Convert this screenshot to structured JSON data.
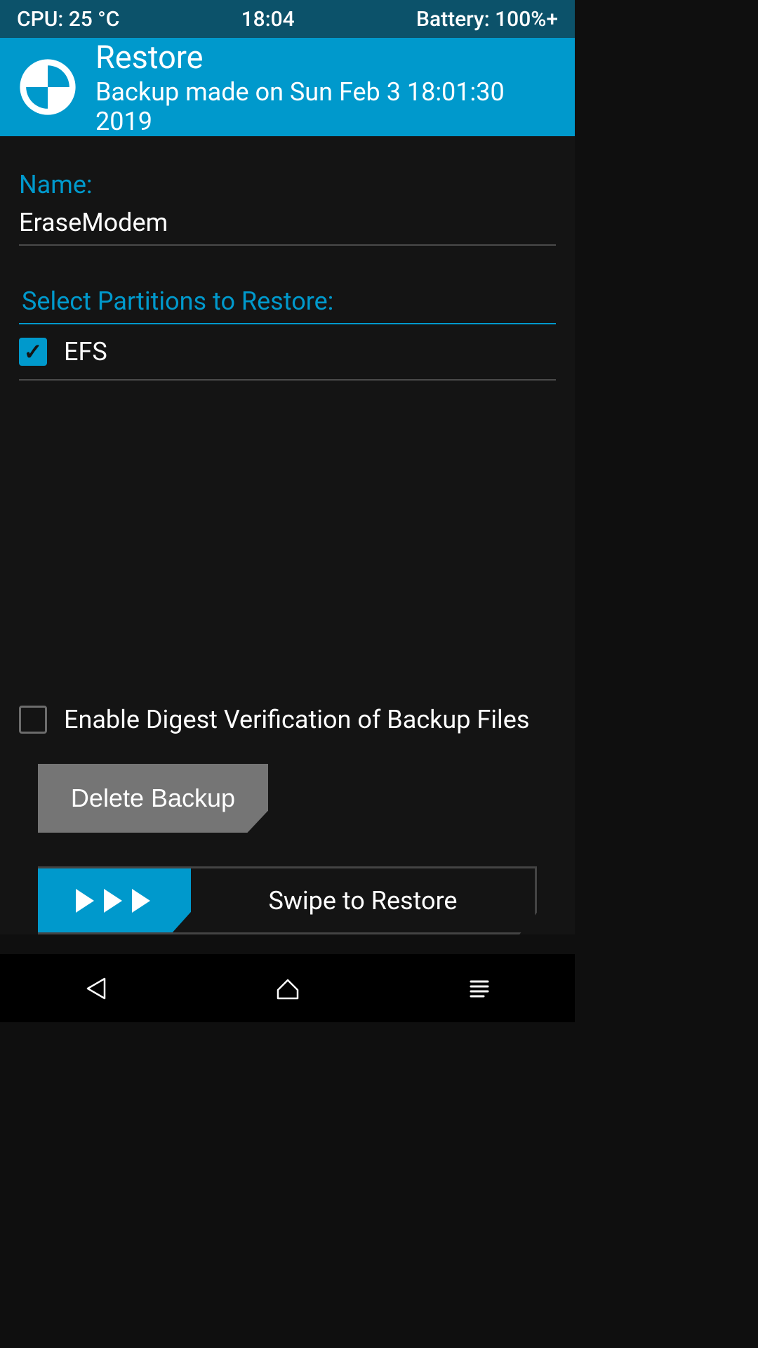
{
  "status_bar": {
    "cpu_temp": "CPU: 25 °C",
    "time": "18:04",
    "battery": "Battery: 100%+"
  },
  "header": {
    "title": "Restore",
    "subtitle": "Backup made on Sun Feb  3 18:01:30 2019"
  },
  "name_section": {
    "label": "Name:",
    "value": "EraseModem"
  },
  "partitions": {
    "section_title": "Select Partitions to Restore:",
    "items": [
      {
        "label": "EFS",
        "checked": true
      }
    ]
  },
  "digest_option": {
    "label": "Enable Digest Verification of Backup Files",
    "checked": false
  },
  "buttons": {
    "delete": "Delete Backup",
    "swipe": "Swipe to Restore"
  },
  "colors": {
    "accent": "#0099cc",
    "dark_accent": "#0c526a",
    "bg": "#141414",
    "button_gray": "#757575"
  }
}
